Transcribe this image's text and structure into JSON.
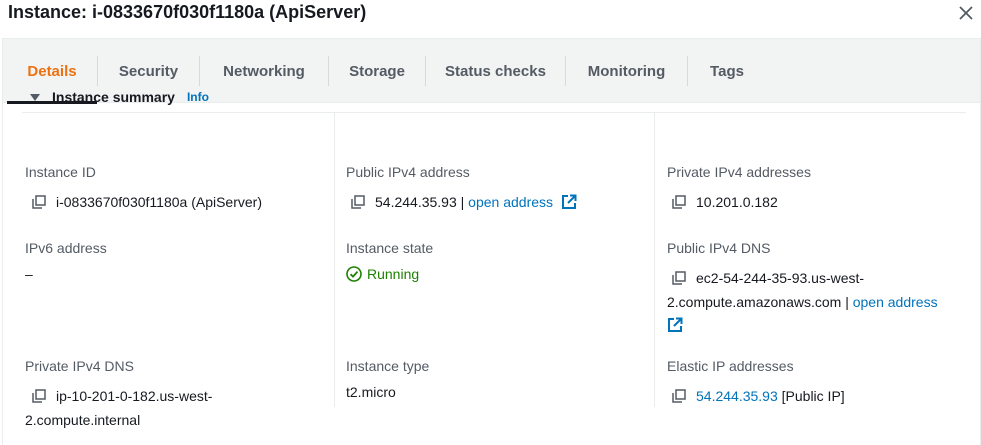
{
  "header": {
    "title": "Instance: i-0833670f030f1180a (ApiServer)",
    "close_icon": "close-icon"
  },
  "tabs": [
    {
      "label": "Details",
      "active": true
    },
    {
      "label": "Security",
      "active": false
    },
    {
      "label": "Networking",
      "active": false
    },
    {
      "label": "Storage",
      "active": false
    },
    {
      "label": "Status checks",
      "active": false
    },
    {
      "label": "Monitoring",
      "active": false
    },
    {
      "label": "Tags",
      "active": false
    }
  ],
  "summary": {
    "title": "Instance summary",
    "info": "Info",
    "fields": {
      "instance_id": {
        "label": "Instance ID",
        "value": "i-0833670f030f1180a (ApiServer)"
      },
      "public_ipv4": {
        "label": "Public IPv4 address",
        "value": "54.244.35.93",
        "separator": "|",
        "link": "open address"
      },
      "private_ipv4": {
        "label": "Private IPv4 addresses",
        "value": "10.201.0.182"
      },
      "ipv6": {
        "label": "IPv6 address",
        "value": "–"
      },
      "instance_state": {
        "label": "Instance state",
        "value": "Running"
      },
      "public_dns": {
        "label": "Public IPv4 DNS",
        "line1": "ec2-54-244-35-93.us-west-",
        "line2": "2.compute.amazonaws.com",
        "separator": "|",
        "link": "open address"
      },
      "private_dns": {
        "label": "Private IPv4 DNS",
        "line1": "ip-10-201-0-182.us-west-",
        "line2": "2.compute.internal"
      },
      "instance_type": {
        "label": "Instance type",
        "value": "t2.micro"
      },
      "elastic_ip": {
        "label": "Elastic IP addresses",
        "link": "54.244.35.93",
        "suffix": "[Public IP]"
      }
    }
  },
  "colors": {
    "accent_tab": "#ec7211",
    "link": "#0073bb",
    "success": "#1d8102",
    "tab_bar_bg": "#f2f3f3"
  }
}
